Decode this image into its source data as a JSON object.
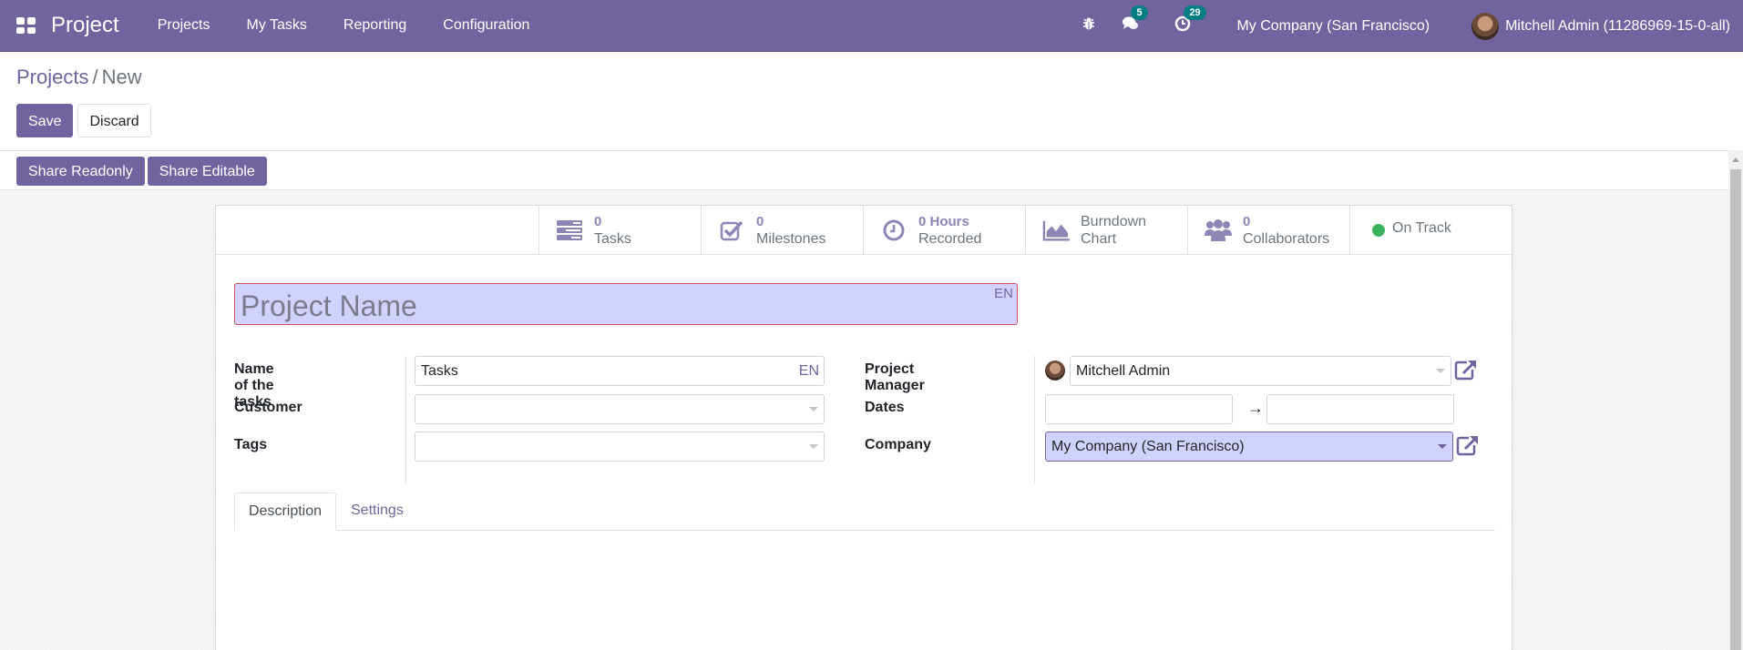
{
  "navbar": {
    "app_name": "Project",
    "menu": [
      "Projects",
      "My Tasks",
      "Reporting",
      "Configuration"
    ],
    "icons": {
      "debug": "bug-icon",
      "messages": "chat-icon",
      "activities": "clock-icon"
    },
    "messages_count": "5",
    "activities_count": "29",
    "company": "My Company (San Francisco)",
    "user": "Mitchell Admin (11286969-15-0-all)"
  },
  "breadcrumb": {
    "parent": "Projects",
    "separator": "/",
    "current": "New"
  },
  "control": {
    "save_label": "Save",
    "discard_label": "Discard"
  },
  "share": {
    "readonly_label": "Share Readonly",
    "editable_label": "Share Editable"
  },
  "stats": [
    {
      "icon": "tasks-icon",
      "value": "0",
      "label": "Tasks"
    },
    {
      "icon": "check-square-icon",
      "value": "0",
      "label": "Milestones"
    },
    {
      "icon": "clock-icon",
      "value": "0 Hours",
      "label": "Recorded"
    },
    {
      "icon": "area-chart-icon",
      "value": "Burndown",
      "label": "Chart"
    },
    {
      "icon": "users-icon",
      "value": "0",
      "label": "Collaborators"
    },
    {
      "icon": "status-dot",
      "value": "",
      "label": "On Track",
      "color": "#3bb35c"
    }
  ],
  "form": {
    "name_placeholder": "Project Name",
    "lang": "EN",
    "left": {
      "task_name_label": "Name of the tasks",
      "task_name_value": "Tasks",
      "customer_label": "Customer",
      "customer_value": "",
      "tags_label": "Tags",
      "tags_value": ""
    },
    "right": {
      "manager_label": "Project Manager",
      "manager_value": "Mitchell Admin",
      "dates_label": "Dates",
      "date_start": "",
      "date_end": "",
      "date_arrow": "→",
      "company_label": "Company",
      "company_value": "My Company (San Francisco)"
    }
  },
  "tabs": [
    {
      "label": "Description",
      "active": true
    },
    {
      "label": "Settings",
      "active": false
    }
  ],
  "colors": {
    "brand": "#71639e",
    "highlight": "#d2d2ff",
    "required_border": "#d44c59",
    "badge": "#017e84"
  }
}
